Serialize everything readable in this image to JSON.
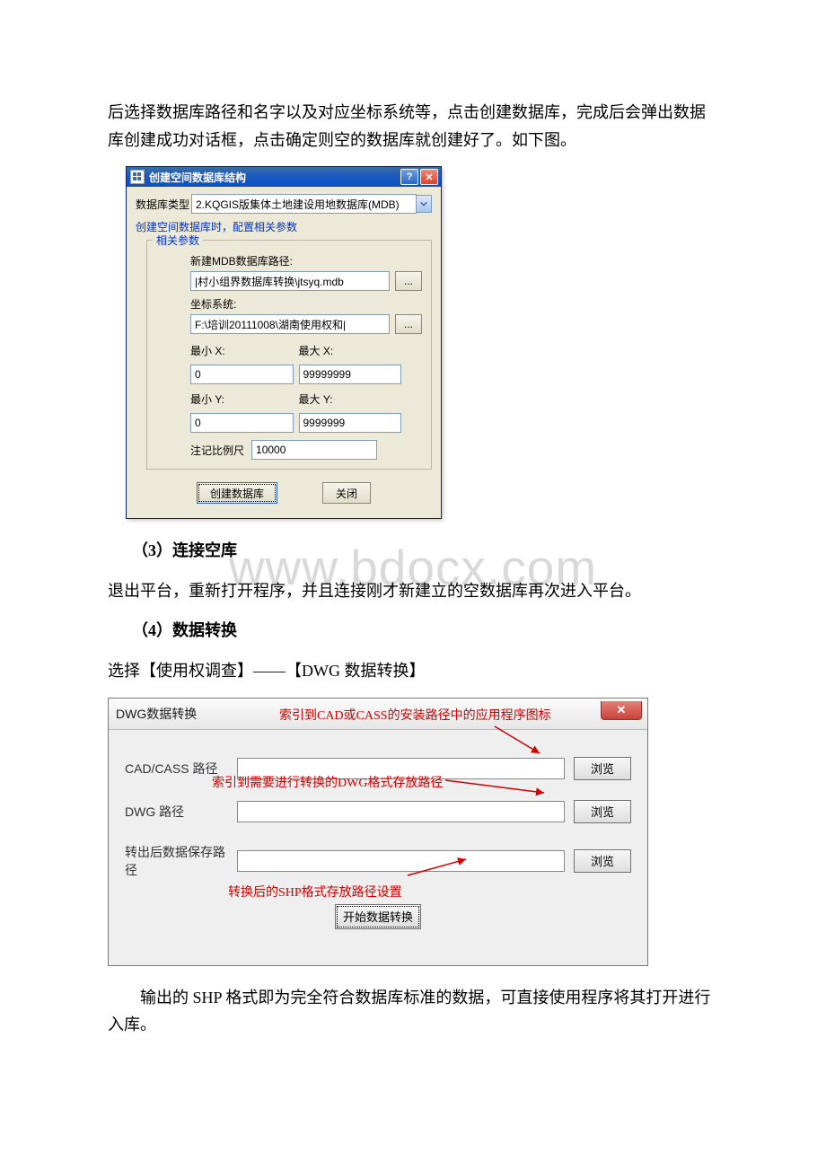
{
  "watermark": "www.bdocx.com",
  "doc": {
    "p1": "后选择数据库路径和名字以及对应坐标系统等，点击创建数据库，完成后会弹出数据库创建成功对话框，点击确定则空的数据库就创建好了。如下图。",
    "h3": "（3）连接空库",
    "p2": "退出平台，重新打开程序，并且连接刚才新建立的空数据库再次进入平台。",
    "h4": "（4）数据转换",
    "p3": "选择【使用权调查】——【DWG 数据转换】",
    "p4": "输出的 SHP 格式即为完全符合数据库标准的数据，可直接使用程序将其打开进行入库。"
  },
  "dialog1": {
    "title": "创建空间数据库结构",
    "db_type_label": "数据库类型",
    "db_type_value": "2.KQGIS版集体土地建设用地数据库(MDB)",
    "hint": "创建空间数据库时，配置相关参数",
    "legend": "相关参数",
    "mdb_path_label": "新建MDB数据库路径:",
    "mdb_path_value": "|村小组界数据库转换\\jtsyq.mdb",
    "coord_label": "坐标系统:",
    "coord_value": "F:\\培训20111008\\湖南使用权和|",
    "minx_label": "最小 X:",
    "maxx_label": "最大 X:",
    "miny_label": "最小 Y:",
    "maxy_label": "最大 Y:",
    "minx": "0",
    "maxx": "99999999",
    "miny": "0",
    "maxy": "9999999",
    "scale_label": "注记比例尺",
    "scale": "10000",
    "create_btn": "创建数据库",
    "close_btn": "关闭",
    "browse": "..."
  },
  "dialog2": {
    "title": "DWG数据转换",
    "label_cad": "CAD/CASS 路径",
    "label_dwg": "DWG 路径",
    "label_out": "转出后数据保存路径",
    "browse": "浏览",
    "start": "开始数据转换",
    "annot1": "索引到CAD或CASS的安装路径中的应用程序图标",
    "annot2": "索引到需要进行转换的DWG格式存放路径",
    "annot3": "转换后的SHP格式存放路径设置"
  }
}
